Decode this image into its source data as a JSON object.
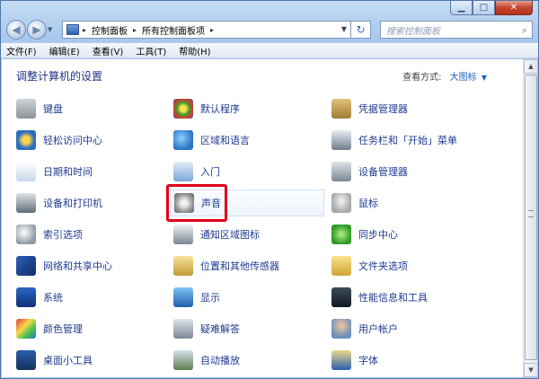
{
  "window": {
    "caption": {
      "minimize": "▁",
      "maximize": "□",
      "close": "✕"
    }
  },
  "nav": {
    "back_icon": "back-arrow-icon",
    "forward_icon": "forward-arrow-icon",
    "breadcrumb": [
      "控制面板",
      "所有控制面板项"
    ],
    "search_placeholder": "搜索控制面板"
  },
  "menu": [
    "文件(F)",
    "编辑(E)",
    "查看(V)",
    "工具(T)",
    "帮助(H)"
  ],
  "content": {
    "title": "调整计算机的设置",
    "view_by_label": "查看方式:",
    "view_by_value": "大图标"
  },
  "items": [
    [
      "键盘",
      "默认程序",
      "凭据管理器"
    ],
    [
      "轻松访问中心",
      "区域和语言",
      "任务栏和「开始」菜单"
    ],
    [
      "日期和时间",
      "入门",
      "设备管理器"
    ],
    [
      "设备和打印机",
      "声音",
      "鼠标"
    ],
    [
      "索引选项",
      "通知区域图标",
      "同步中心"
    ],
    [
      "网络和共享中心",
      "位置和其他传感器",
      "文件夹选项"
    ],
    [
      "系统",
      "显示",
      "性能信息和工具"
    ],
    [
      "颜色管理",
      "疑难解答",
      "用户帐户"
    ],
    [
      "桌面小工具",
      "自动播放",
      "字体"
    ]
  ],
  "highlighted_item": "声音",
  "colors": {
    "highlight_border": "#e1001a",
    "link": "#1f3a8f"
  }
}
